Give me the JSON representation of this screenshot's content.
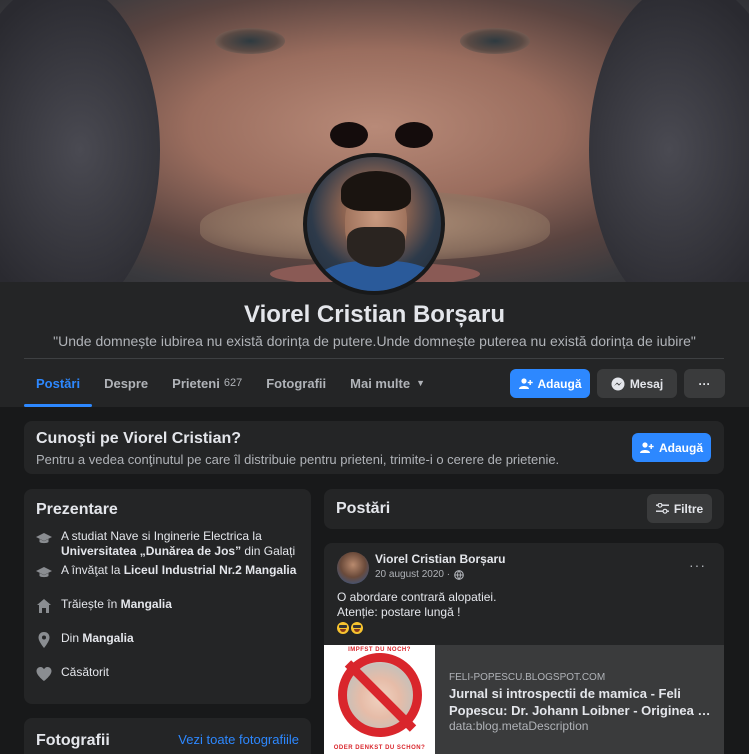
{
  "profile": {
    "name": "Viorel Cristian Borșaru",
    "bio": "\"Unde domnește iubirea nu există dorința de putere.Unde domnește puterea nu există dorința de iubire\""
  },
  "tabs": [
    {
      "label": "Postări",
      "active": true
    },
    {
      "label": "Despre"
    },
    {
      "label": "Prieteni",
      "count": "627"
    },
    {
      "label": "Fotografii"
    },
    {
      "label": "Mai multe"
    }
  ],
  "actions": {
    "add_label": "Adaugă",
    "message_label": "Mesaj",
    "more_label": "···"
  },
  "know": {
    "title": "Cunoşti pe Viorel Cristian?",
    "subtitle": "Pentru a vedea conţinutul pe care îl distribuie pentru prieteni, trimite-i o cerere de prietenie.",
    "button": "Adaugă"
  },
  "intro": {
    "title": "Prezentare",
    "items": [
      {
        "icon": "graduation-cap-icon",
        "text1": "A studiat Nave si Inginerie Electrica la",
        "bold": "Universitatea „Dunărea de Jos”",
        "text2": " din Galați"
      },
      {
        "icon": "graduation-cap-icon",
        "text1": "A învăţat la ",
        "bold": "Liceul Industrial Nr.2 Mangalia",
        "text2": ""
      },
      {
        "icon": "home-icon",
        "text1": "Trăiește în ",
        "bold": "Mangalia",
        "text2": ""
      },
      {
        "icon": "location-pin-icon",
        "text1": "Din ",
        "bold": "Mangalia",
        "text2": ""
      },
      {
        "icon": "heart-icon",
        "text1": "Căsătorit",
        "bold": "",
        "text2": ""
      }
    ]
  },
  "photos": {
    "title": "Fotografii",
    "link": "Vezi toate fotografiile"
  },
  "posts": {
    "title": "Postări",
    "filter_label": "Filtre"
  },
  "post": {
    "author": "Viorel Cristian Borșaru",
    "date": "20 august 2020 ·",
    "more": "···",
    "line1": "O abordare contrară alopatiei.",
    "line2": "Atenție: postare lungă !",
    "link": {
      "domain": "FELI-POPESCU.BLOGSPOT.COM",
      "title_line1": "Jurnal si introspectii de mamica - Feli",
      "title_line2": "Popescu: Dr. Johann Loibner - Originea s...",
      "description": "data:blog.metaDescription",
      "stamp_top": "IMPFST DU NOCH?",
      "stamp_bottom": "ODER DENKST DU SCHON?"
    }
  },
  "colors": {
    "accent": "#2d88ff",
    "card": "#242526",
    "background": "#18191a"
  }
}
